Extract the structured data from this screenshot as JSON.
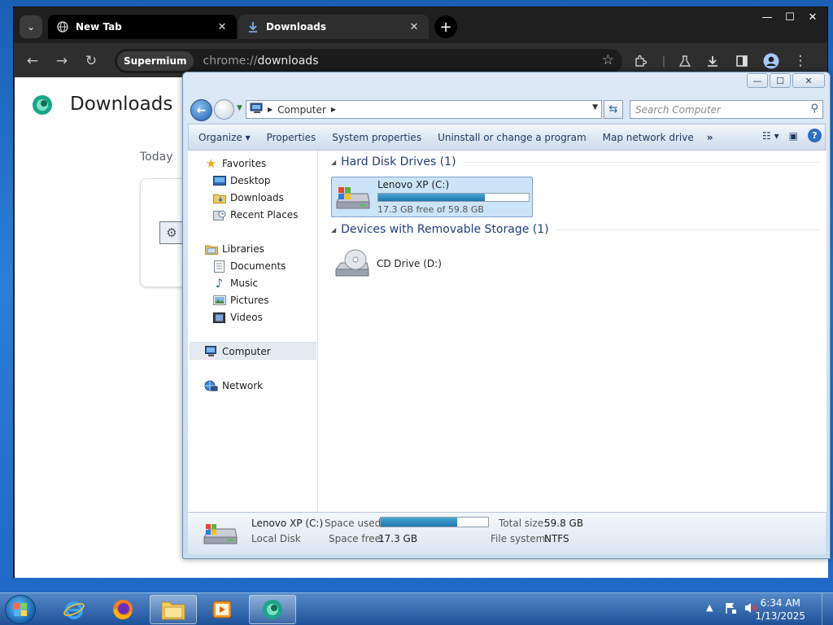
{
  "browser": {
    "tabs": [
      {
        "label": "New Tab",
        "close": "✕"
      },
      {
        "label": "Downloads",
        "close": "✕"
      }
    ],
    "new_tab": "+",
    "window_controls": {
      "minimize": "—",
      "maximize": "☐",
      "close": "✕"
    },
    "toolbar": {
      "back": "←",
      "forward": "→",
      "reload": "↻"
    },
    "site_chip": "Supermium",
    "url_scheme": "chrome://",
    "url_host": "downloads",
    "page": {
      "title": "Downloads",
      "section": "Today"
    }
  },
  "explorer": {
    "window_controls": {
      "minimize": "—",
      "maximize": "☐",
      "close": "✕"
    },
    "address": {
      "location": "Computer"
    },
    "search_placeholder": "Search Computer",
    "commands": [
      "Organize ▾",
      "Properties",
      "System properties",
      "Uninstall or change a program",
      "Map network drive",
      "»"
    ],
    "nav": {
      "favorites": "Favorites",
      "desktop": "Desktop",
      "downloads": "Downloads",
      "recent_places": "Recent Places",
      "libraries": "Libraries",
      "documents": "Documents",
      "music": "Music",
      "pictures": "Pictures",
      "videos": "Videos",
      "computer": "Computer",
      "network": "Network"
    },
    "groups": {
      "hard_disks": "Hard Disk Drives (1)",
      "removable": "Devices with Removable Storage (1)"
    },
    "drive_c": {
      "name": "Lenovo XP (C:)",
      "free_text": "17.3 GB free of 59.8 GB",
      "used_fraction": 0.71
    },
    "drive_d": {
      "name": "CD Drive (D:)"
    },
    "details": {
      "name": "Lenovo XP (C:)",
      "type": "Local Disk",
      "space_used_label": "Space used:",
      "space_free_label": "Space free:",
      "space_free": "17.3 GB",
      "total_size_label": "Total size:",
      "total_size": "59.8 GB",
      "file_system_label": "File system:",
      "file_system": "NTFS"
    }
  },
  "taskbar": {
    "clock_time": "6:34 AM",
    "clock_date": "1/13/2025"
  }
}
